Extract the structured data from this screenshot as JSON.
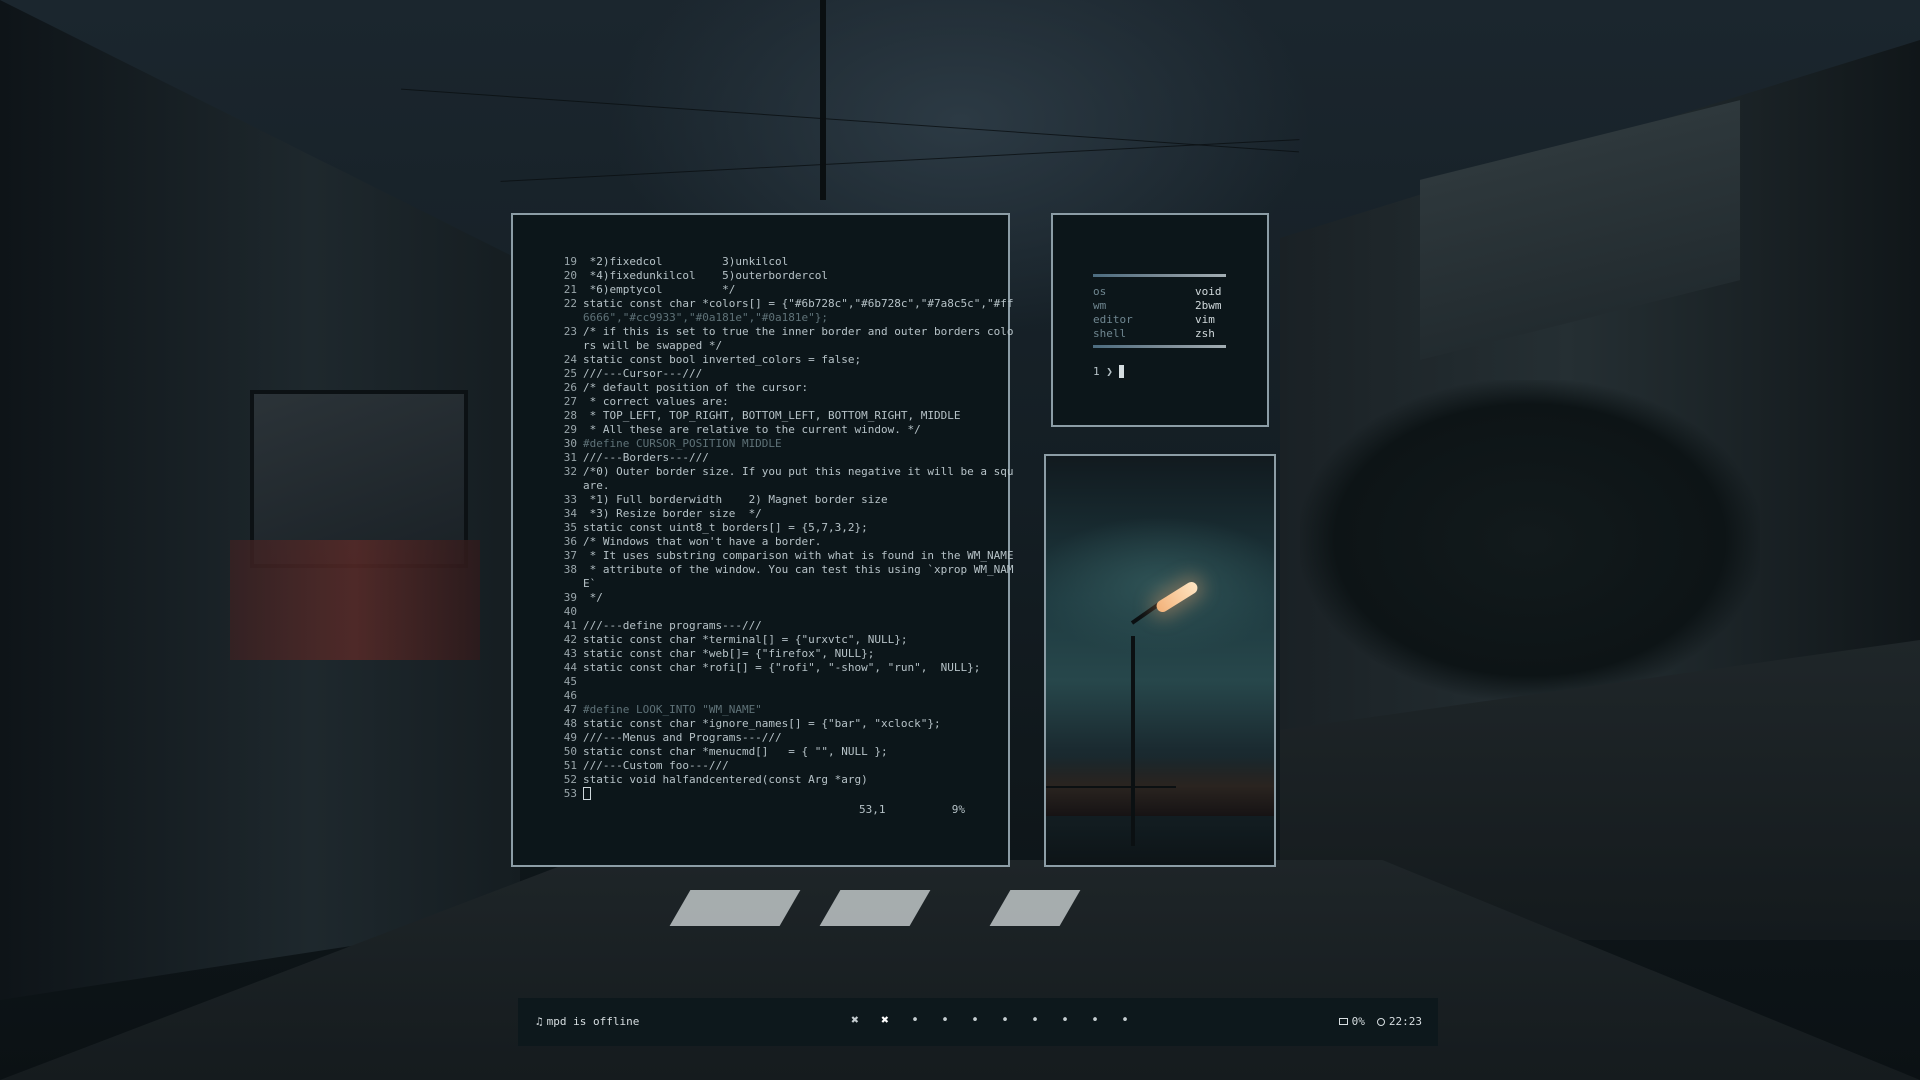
{
  "editor": {
    "lines": [
      {
        "n": "19",
        "t": " *2)fixedcol         3)unkilcol",
        "s": "normal"
      },
      {
        "n": "20",
        "t": " *4)fixedunkilcol    5)outerbordercol",
        "s": "normal"
      },
      {
        "n": "21",
        "t": " *6)emptycol         */",
        "s": "normal"
      },
      {
        "n": "22",
        "t": "static const char *colors[] = {\"#6b728c\",\"#6b728c\",\"#7a8c5c\",\"#ff",
        "s": "mix"
      },
      {
        "n": "",
        "t": "6666\",\"#cc9933\",\"#0a181e\",\"#0a181e\"};",
        "s": "dim"
      },
      {
        "n": "23",
        "t": "/* if this is set to true the inner border and outer borders colo",
        "s": "normal"
      },
      {
        "n": "",
        "t": "rs will be swapped */",
        "s": "normal"
      },
      {
        "n": "24",
        "t": "static const bool inverted_colors = false;",
        "s": "mix"
      },
      {
        "n": "25",
        "t": "///---Cursor---///",
        "s": "normal"
      },
      {
        "n": "26",
        "t": "/* default position of the cursor:",
        "s": "normal"
      },
      {
        "n": "27",
        "t": " * correct values are:",
        "s": "normal"
      },
      {
        "n": "28",
        "t": " * TOP_LEFT, TOP_RIGHT, BOTTOM_LEFT, BOTTOM_RIGHT, MIDDLE",
        "s": "normal"
      },
      {
        "n": "29",
        "t": " * All these are relative to the current window. */",
        "s": "normal"
      },
      {
        "n": "30",
        "t": "#define CURSOR_POSITION MIDDLE",
        "s": "dim"
      },
      {
        "n": "31",
        "t": "///---Borders---///",
        "s": "normal"
      },
      {
        "n": "32",
        "t": "/*0) Outer border size. If you put this negative it will be a squ",
        "s": "normal"
      },
      {
        "n": "",
        "t": "are.",
        "s": "normal"
      },
      {
        "n": "33",
        "t": " *1) Full borderwidth    2) Magnet border size",
        "s": "normal"
      },
      {
        "n": "34",
        "t": " *3) Resize border size  */",
        "s": "normal"
      },
      {
        "n": "35",
        "t": "static const uint8_t borders[] = {5,7,3,2};",
        "s": "mix"
      },
      {
        "n": "36",
        "t": "/* Windows that won't have a border.",
        "s": "normal"
      },
      {
        "n": "37",
        "t": " * It uses substring comparison with what is found in the WM_NAME",
        "s": "normal"
      },
      {
        "n": "38",
        "t": " * attribute of the window. You can test this using `xprop WM_NAM",
        "s": "normal"
      },
      {
        "n": "",
        "t": "E`",
        "s": "normal"
      },
      {
        "n": "39",
        "t": " */",
        "s": "normal"
      },
      {
        "n": "40",
        "t": "",
        "s": "normal"
      },
      {
        "n": "41",
        "t": "///---define programs---///",
        "s": "normal"
      },
      {
        "n": "42",
        "t": "static const char *terminal[] = {\"urxvtc\", NULL};",
        "s": "mix"
      },
      {
        "n": "43",
        "t": "static const char *web[]= {\"firefox\", NULL};",
        "s": "mix"
      },
      {
        "n": "44",
        "t": "static const char *rofi[] = {\"rofi\", \"-show\", \"run\",  NULL};",
        "s": "mix"
      },
      {
        "n": "45",
        "t": "",
        "s": "normal"
      },
      {
        "n": "46",
        "t": "",
        "s": "normal"
      },
      {
        "n": "47",
        "t": "#define LOOK_INTO \"WM_NAME\"",
        "s": "dim"
      },
      {
        "n": "48",
        "t": "static const char *ignore_names[] = {\"bar\", \"xclock\"};",
        "s": "mix"
      },
      {
        "n": "49",
        "t": "///---Menus and Programs---///",
        "s": "normal"
      },
      {
        "n": "50",
        "t": "static const char *menucmd[]   = { \"\", NULL };",
        "s": "mix"
      },
      {
        "n": "51",
        "t": "///---Custom foo---///",
        "s": "normal"
      },
      {
        "n": "52",
        "t": "static void halfandcentered(const Arg *arg)",
        "s": "mix"
      },
      {
        "n": "53",
        "t": "",
        "s": "cursor"
      }
    ],
    "ruler_pos": "53,1",
    "ruler_pct": "9%"
  },
  "fetch": {
    "rows": [
      {
        "key": "os",
        "val": "void"
      },
      {
        "key": "wm",
        "val": "2bwm"
      },
      {
        "key": "editor",
        "val": "vim"
      },
      {
        "key": "shell",
        "val": "zsh"
      }
    ],
    "prompt": "1 ❯"
  },
  "bar": {
    "music_icon": "music-note-icon",
    "music_text": "mpd is offline",
    "workspaces": [
      "✖",
      "✖",
      "•",
      "•",
      "•",
      "•",
      "•",
      "•",
      "•",
      "•"
    ],
    "active_workspace": 1,
    "battery_icon": "battery-icon",
    "battery": "0%",
    "clock_icon": "clock-icon",
    "time": "22:23"
  },
  "colors": {
    "background": "#0c161a",
    "border": "#8c9da6",
    "text": "#b6c2c7",
    "dim": "#5f7278"
  }
}
